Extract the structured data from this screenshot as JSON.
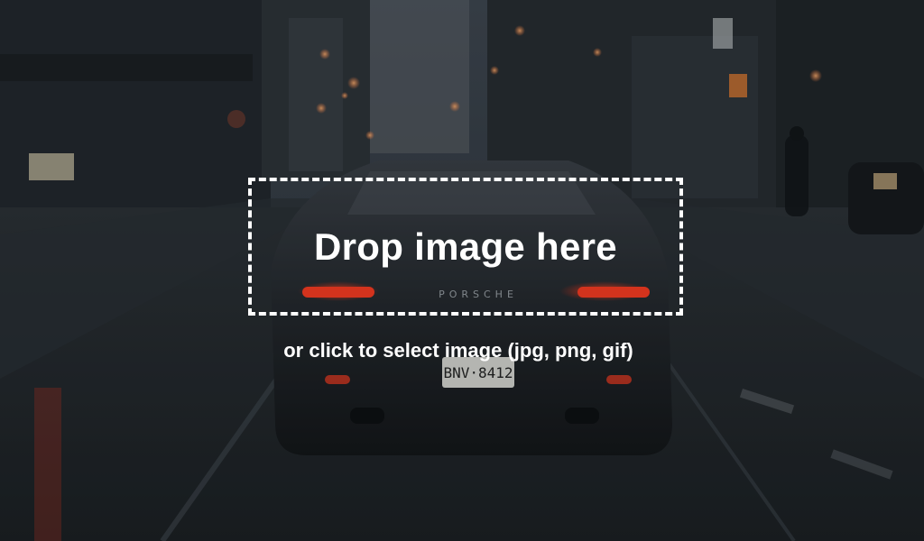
{
  "dropzone": {
    "title": "Drop image here",
    "hint": "or click to select image (jpg, png, gif)",
    "accept": "image/jpeg,image/png,image/gif"
  },
  "background": {
    "plate_text": "BNV·8412",
    "badge_text": "PORSCHE",
    "icon": "background-photo"
  },
  "colors": {
    "border": "#ffffff",
    "text": "#ffffff",
    "taillight": "#ff3b20"
  }
}
